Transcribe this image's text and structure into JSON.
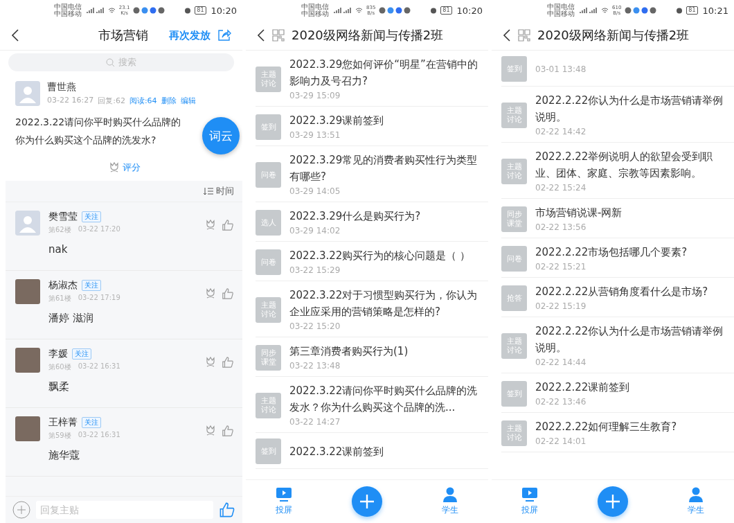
{
  "panels": [
    {
      "kind": "topic",
      "status": {
        "carriers": [
          "中国电信",
          "中国移动"
        ],
        "speed": "23.1",
        "speed_unit": "K/s",
        "battery": "81",
        "time": "10:20"
      },
      "header": {
        "title": "市场营销",
        "action": "再次发放"
      },
      "search": {
        "placeholder": "搜索"
      },
      "post": {
        "author": "曹世燕",
        "time": "03-22 16:27",
        "replies": "回复:62",
        "reads": "阅读:64",
        "actions": [
          "删除",
          "编辑"
        ],
        "body_lines": [
          "2022.3.22请问你平时购买什么品牌的",
          "你为什么购买这个品牌的洗发水?"
        ],
        "fab": "词云",
        "rate": "评分"
      },
      "sort": "时间",
      "replies": [
        {
          "kind": "default_avatar",
          "name": "樊雪莹",
          "follow": "关注",
          "floor": "第62楼",
          "time": "03-22 17:20",
          "text": "nak"
        },
        {
          "kind": "photo_avatar",
          "name": "杨淑杰",
          "follow": "关注",
          "floor": "第61楼",
          "time": "03-22 17:19",
          "text": "潘婷  滋润"
        },
        {
          "kind": "photo_avatar",
          "name": "李媛",
          "follow": "关注",
          "floor": "第60楼",
          "time": "03-22 16:31",
          "text": "飘柔"
        },
        {
          "kind": "photo_avatar",
          "name": "王梓菁",
          "follow": "关注",
          "floor": "第59楼",
          "time": "03-22 16:31",
          "text": "施华蔻"
        }
      ],
      "reply_placeholder": "回复主贴"
    },
    {
      "kind": "list",
      "status": {
        "carriers": [
          "中国电信",
          "中国移动"
        ],
        "speed": "835",
        "speed_unit": "B/s",
        "battery": "81",
        "time": "10:20"
      },
      "header": {
        "title": "2020级网络新闻与传播2班"
      },
      "items": [
        {
          "tag": "主题讨论",
          "title": "2022.3.29您如何评价“明星”在营销中的影响力及号召力?",
          "time": "03-29 15:09"
        },
        {
          "tag": "签到",
          "title": "2022.3.29课前签到",
          "time": "03-29 13:51"
        },
        {
          "tag": "问卷",
          "title": "2022.3.29常见的消费者购买性行为类型有哪些?",
          "time": "03-29 14:05"
        },
        {
          "tag": "选人",
          "title": "2022.3.29什么是购买行为?",
          "time": "03-29 14:02"
        },
        {
          "tag": "问卷",
          "title": "2022.3.22购买行为的核心问题是（   ）",
          "time": "03-22 15:29"
        },
        {
          "tag": "主题讨论",
          "title": "2022.3.22对于习惯型购买行为，你认为企业应采用的营销策略是怎样的?",
          "time": "03-22 15:20"
        },
        {
          "tag": "同步课堂",
          "title": "第三章消费者购买行为(1)",
          "time": "03-22 13:48"
        },
        {
          "tag": "主题讨论",
          "title": "2022.3.22请问你平时购买什么品牌的洗发水？你为什么购买这个品牌的洗...",
          "time": "03-22 14:27"
        },
        {
          "tag": "签到",
          "title": "2022.3.22课前签到"
        }
      ],
      "nav": {
        "left": "投屏",
        "right": "学生"
      }
    },
    {
      "kind": "list",
      "status": {
        "carriers": [
          "中国电信",
          "中国移动"
        ],
        "speed": "610",
        "speed_unit": "B/s",
        "battery": "81",
        "time": "10:21"
      },
      "header": {
        "title": "2020级网络新闻与传播2班"
      },
      "items": [
        {
          "tag": "签到",
          "time": "03-01 13:48"
        },
        {
          "tag": "主题讨论",
          "title": "2022.2.22你认为什么是市场营销请举例说明。",
          "time": "02-22 14:42"
        },
        {
          "tag": "主题讨论",
          "title": "2022.2.22举例说明人的欲望会受到职业、团体、家庭、宗教等因素影响。",
          "time": "02-22 15:24"
        },
        {
          "tag": "同步课堂",
          "title": "市场营销说课-网新",
          "time": "02-22 13:56"
        },
        {
          "tag": "问卷",
          "title": "2022.2.22市场包括哪几个要素?",
          "time": "02-22 15:21"
        },
        {
          "tag": "抢答",
          "title": "2022.2.22从营销角度看什么是市场?",
          "time": "02-22 15:19"
        },
        {
          "tag": "主题讨论",
          "title": "2022.2.22你认为什么是市场营销请举例说明。",
          "time": "02-22 14:44"
        },
        {
          "tag": "签到",
          "title": "2022.2.22课前签到",
          "time": "02-22 13:46"
        },
        {
          "tag": "主题讨论",
          "title": "2022.2.22如何理解三生教育?",
          "time": "02-22 14:01"
        }
      ],
      "nav": {
        "left": "投屏",
        "right": "学生"
      }
    }
  ]
}
